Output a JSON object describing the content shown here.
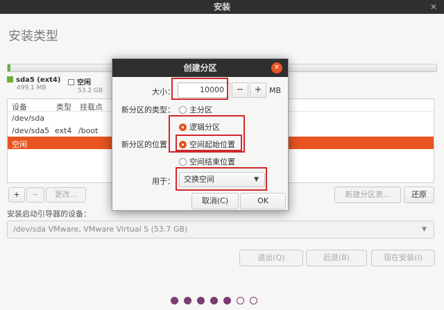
{
  "window": {
    "title": "安装",
    "close_glyph": "✕"
  },
  "page": {
    "title": "安装类型"
  },
  "legend": [
    {
      "name": "sda5 (ext4)",
      "size": "499.1 MB",
      "color": "#6dad3e"
    },
    {
      "name": "空闲",
      "size": "53.2 GB",
      "color": "#ffffff"
    }
  ],
  "table": {
    "headers": [
      "设备",
      "类型",
      "挂载点"
    ],
    "rows": [
      {
        "device": "/dev/sda",
        "type": "",
        "mount": ""
      },
      {
        "device": "/dev/sda5",
        "type": "ext4",
        "mount": "/boot"
      },
      {
        "device": "空闲",
        "type": "",
        "mount": "",
        "selected": true
      }
    ]
  },
  "table_buttons": {
    "add": "+",
    "remove": "−",
    "change": "更改..."
  },
  "right_buttons": {
    "new_table": "新建分区表...",
    "revert": "还原"
  },
  "boot": {
    "label": "安装启动引导器的设备：",
    "value": "/dev/sda   VMware, VMware Virtual S (53.7 GB)"
  },
  "nav": {
    "quit": "退出(Q)",
    "back": "后退(B)",
    "install": "现在安装(I)"
  },
  "progress": {
    "total_steps": 7,
    "completed_steps": 5
  },
  "dialog": {
    "title": "创建分区",
    "size_label": "大小：",
    "size_value": "10000",
    "minus": "−",
    "plus": "+",
    "unit": "MB",
    "type_label": "新分区的类型：",
    "type_primary": "主分区",
    "type_logical": "逻辑分区",
    "location_label": "新分区的位置：",
    "loc_begin": "空间起始位置",
    "loc_end": "空间结束位置",
    "use_label": "用于：",
    "use_value": "交换空间",
    "cancel": "取消(C)",
    "ok": "OK",
    "accent_color": "#e95420",
    "highlight_color": "#d1272b"
  }
}
